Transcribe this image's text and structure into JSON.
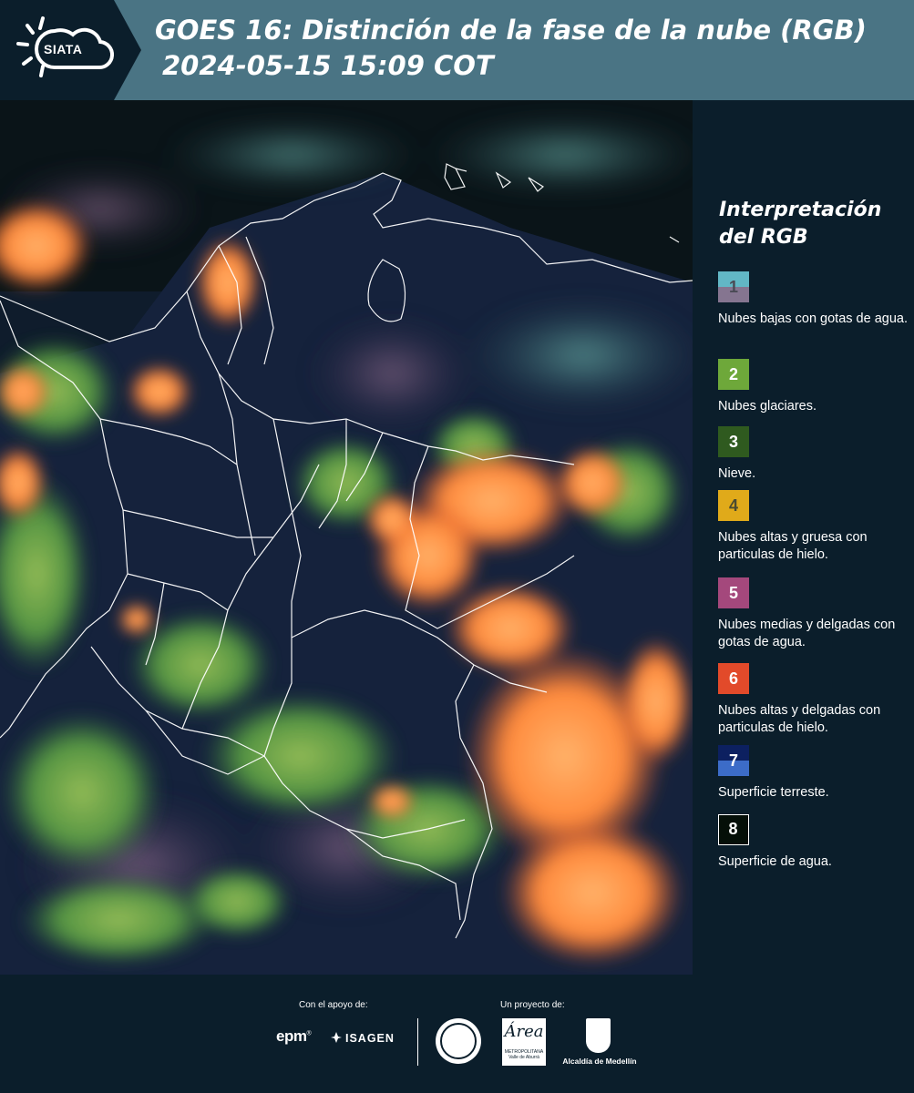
{
  "header": {
    "logo_text": "SIATA",
    "title_line1": "GOES 16: Distinción de la fase de la nube (RGB)",
    "title_line2": "2024-05-15 15:09 COT",
    "background_color": "#4a7484"
  },
  "map": {
    "description_icon": "satellite-rgb-map",
    "colors": {
      "cloud_orange": "#ff8a3c",
      "cloud_green": "#7fbf4a",
      "surface": "#16233f",
      "border": "#ffffff"
    }
  },
  "legend": {
    "title": "Interpretación del RGB",
    "items": [
      {
        "number": "1",
        "label": "Nubes bajas con gotas de agua.",
        "color_top": "#62b7c5",
        "color_bottom": "#857590",
        "num_color": "#4a4a55"
      },
      {
        "number": "2",
        "label": "Nubes glaciares.",
        "color_top": "#6ea83a",
        "color_bottom": "#6ea83a",
        "num_color": "#ffffff"
      },
      {
        "number": "3",
        "label": "Nieve.",
        "color_top": "#2f5a1f",
        "color_bottom": "#2f5a1f",
        "num_color": "#ffffff"
      },
      {
        "number": "4",
        "label": "Nubes altas y gruesa con particulas de hielo.",
        "color_top": "#e0aa1a",
        "color_bottom": "#e0aa1a",
        "num_color": "#4a4a30"
      },
      {
        "number": "5",
        "label": "Nubes medias y delgadas con gotas de agua.",
        "color_top": "#a4487c",
        "color_bottom": "#a4487c",
        "num_color": "#ffffff"
      },
      {
        "number": "6",
        "label": "Nubes altas y delgadas con particulas de hielo.",
        "color_top": "#e24a2a",
        "color_bottom": "#e24a2a",
        "num_color": "#ffffff"
      },
      {
        "number": "7",
        "label": "Superficie terreste.",
        "color_top": "#0c2060",
        "color_bottom": "#3c6cc8",
        "num_color": "#ffffff"
      },
      {
        "number": "8",
        "label": "Superficie de agua.",
        "color_top": "#050f08",
        "color_bottom": "#050f08",
        "num_color": "#ffffff"
      }
    ]
  },
  "footer": {
    "support_label": "Con el apoyo de:",
    "project_label": "Un proyecto de:",
    "epm": "epm",
    "epm_mark": "®",
    "isagen": "ISAGEN",
    "area_word": "Área",
    "area_sub": "METROPOLITANA Valle de Aburrá",
    "medellin": "Alcaldía de Medellín"
  }
}
